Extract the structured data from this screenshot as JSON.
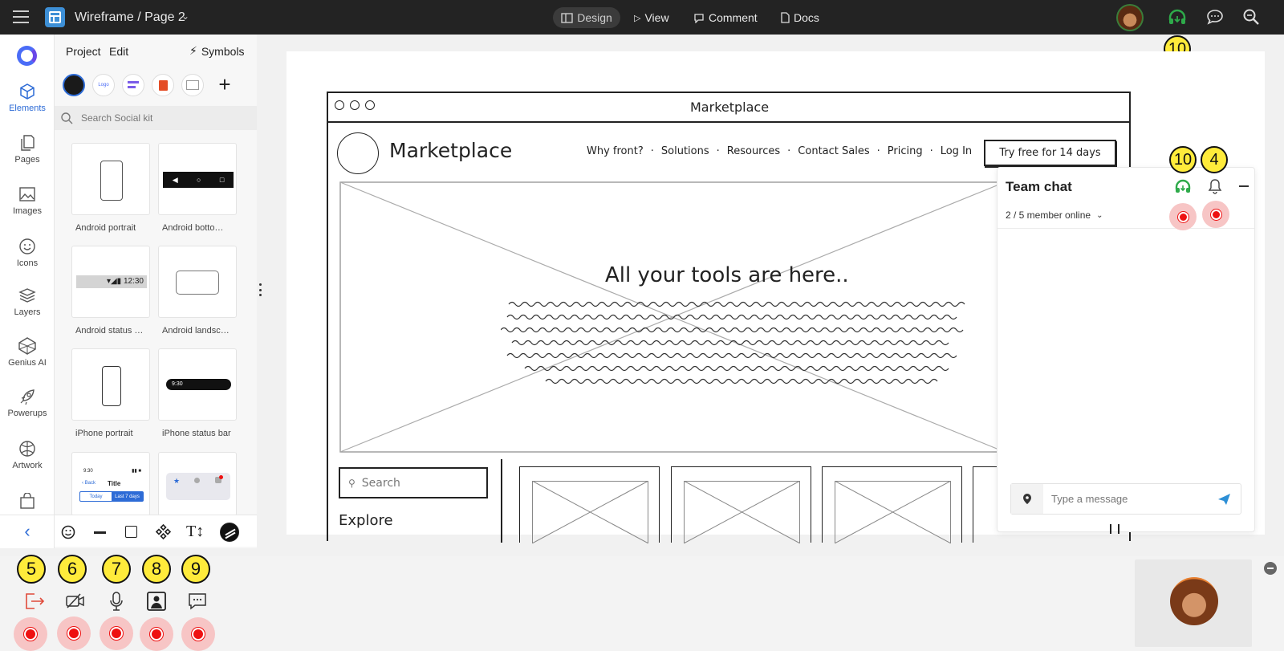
{
  "topbar": {
    "title": "Wireframe / Page 2",
    "tabs": [
      {
        "label": "Design",
        "active": true
      },
      {
        "label": "View"
      },
      {
        "label": "Comment"
      },
      {
        "label": "Docs"
      }
    ],
    "badge_number": "10"
  },
  "sidebar": {
    "items": [
      {
        "label": "Elements",
        "icon": "cube-icon"
      },
      {
        "label": "Pages",
        "icon": "pages-icon"
      },
      {
        "label": "Images",
        "icon": "image-icon"
      },
      {
        "label": "Icons",
        "icon": "smiley-icon"
      },
      {
        "label": "Layers",
        "icon": "layers-icon"
      },
      {
        "label": "Genius AI",
        "icon": "ai-icon"
      },
      {
        "label": "Powerups",
        "icon": "rocket-icon"
      },
      {
        "label": "Artwork",
        "icon": "artwork-icon"
      }
    ]
  },
  "panel": {
    "menu": [
      "Project",
      "Edit"
    ],
    "symbols_label": "Symbols",
    "search_placeholder": "Search Social kit",
    "kit_logo_text": "Logo",
    "cards": [
      {
        "label": "Android portrait"
      },
      {
        "label": "Android botto…"
      },
      {
        "label": "Android status …",
        "time": "12:30"
      },
      {
        "label": "Android landsc…"
      },
      {
        "label": "iPhone portrait"
      },
      {
        "label": "iPhone status bar",
        "time": "9:30"
      },
      {
        "time": "9:30",
        "back": "Back",
        "title": "Title",
        "chip_today": "Today",
        "chip_last": "Last 7 days"
      },
      {}
    ]
  },
  "wireframe": {
    "window_title": "Marketplace",
    "brand": "Marketplace",
    "nav": [
      "Why front?",
      "Solutions",
      "Resources",
      "Contact Sales",
      "Pricing",
      "Log In"
    ],
    "cta": "Try free for 14 days",
    "hero_heading": "All your tools are here..",
    "search_placeholder": "Search",
    "explore": "Explore"
  },
  "chat": {
    "title": "Team chat",
    "members": "2 / 5 member online",
    "input_placeholder": "Type a message",
    "badge_left": "10",
    "badge_right": "4"
  },
  "bottom": {
    "badges": [
      "5",
      "6",
      "7",
      "8",
      "9"
    ]
  },
  "colors": {
    "accent_green": "#2eaa4a",
    "badge_yellow": "#ffeb3b",
    "record_red": "#e11111",
    "topbar_bg": "#232323",
    "active_blue": "#2d6bd6"
  }
}
